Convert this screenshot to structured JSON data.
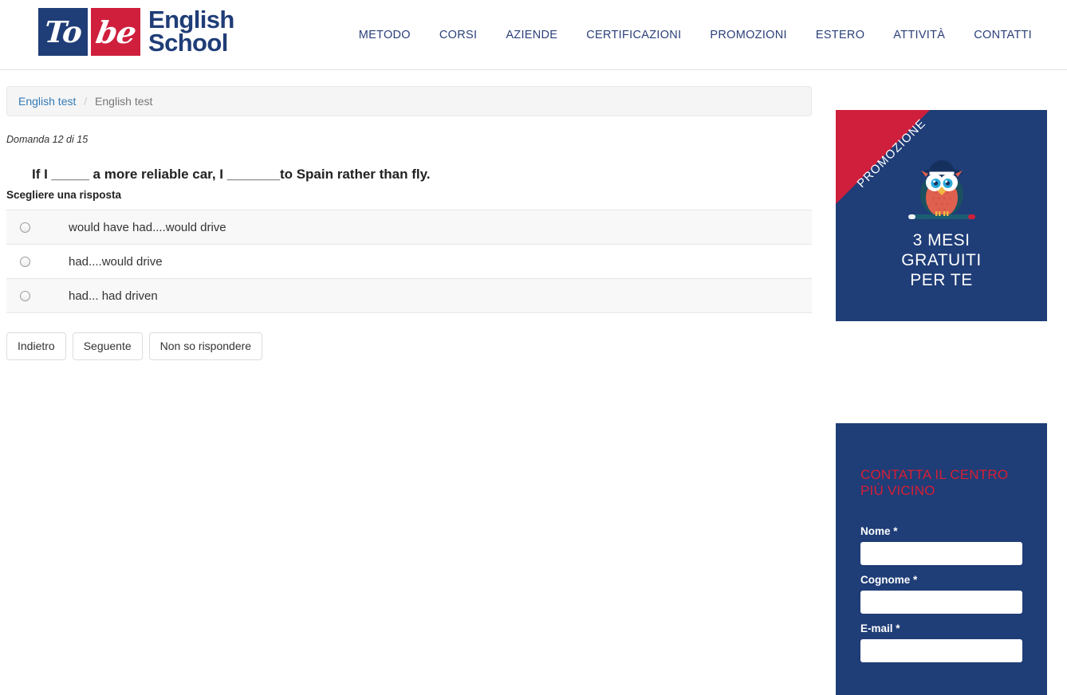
{
  "header": {
    "logo": {
      "square_one": "To",
      "square_two": "be",
      "word_line_one": "English",
      "word_line_two": "School",
      "navy": "#1f3d77",
      "red": "#cf1f3d"
    },
    "nav": [
      {
        "label": "METODO"
      },
      {
        "label": "CORSI"
      },
      {
        "label": "AZIENDE"
      },
      {
        "label": "CERTIFICAZIONI"
      },
      {
        "label": "PROMOZIONI"
      },
      {
        "label": "ESTERO"
      },
      {
        "label": "ATTIVITÀ"
      },
      {
        "label": "CONTATTI"
      }
    ]
  },
  "breadcrumb": {
    "link": "English test",
    "separator": "/",
    "current": "English test"
  },
  "quiz": {
    "progress": "Domanda 12 di 15",
    "question": "If I _____ a more reliable car, I _______to Spain rather than fly.",
    "instruction": "Scegliere una risposta",
    "answers": [
      {
        "label": "would have had....would drive",
        "selected": false
      },
      {
        "label": "had....would drive",
        "selected": false
      },
      {
        "label": "had... had driven",
        "selected": false
      }
    ],
    "buttons": {
      "back": "Indietro",
      "next": "Seguente",
      "skip": "Non so rispondere"
    }
  },
  "promo": {
    "ribbon": "PROMOZIONE",
    "line1": "3 MESI",
    "line2": "GRATUITI",
    "line3": "PER TE",
    "icon": "owl-with-hat-icon",
    "bg_color": "#1f3d77",
    "ribbon_color": "#cf1f3d"
  },
  "contact": {
    "title": "CONTATTA IL CENTRO PIÙ VICINO",
    "title_color": "#d61f35",
    "fields": [
      {
        "label": "Nome *",
        "value": "",
        "placeholder": ""
      },
      {
        "label": "Cognome *",
        "value": "",
        "placeholder": ""
      },
      {
        "label": "E-mail *",
        "value": "",
        "placeholder": ""
      }
    ]
  }
}
